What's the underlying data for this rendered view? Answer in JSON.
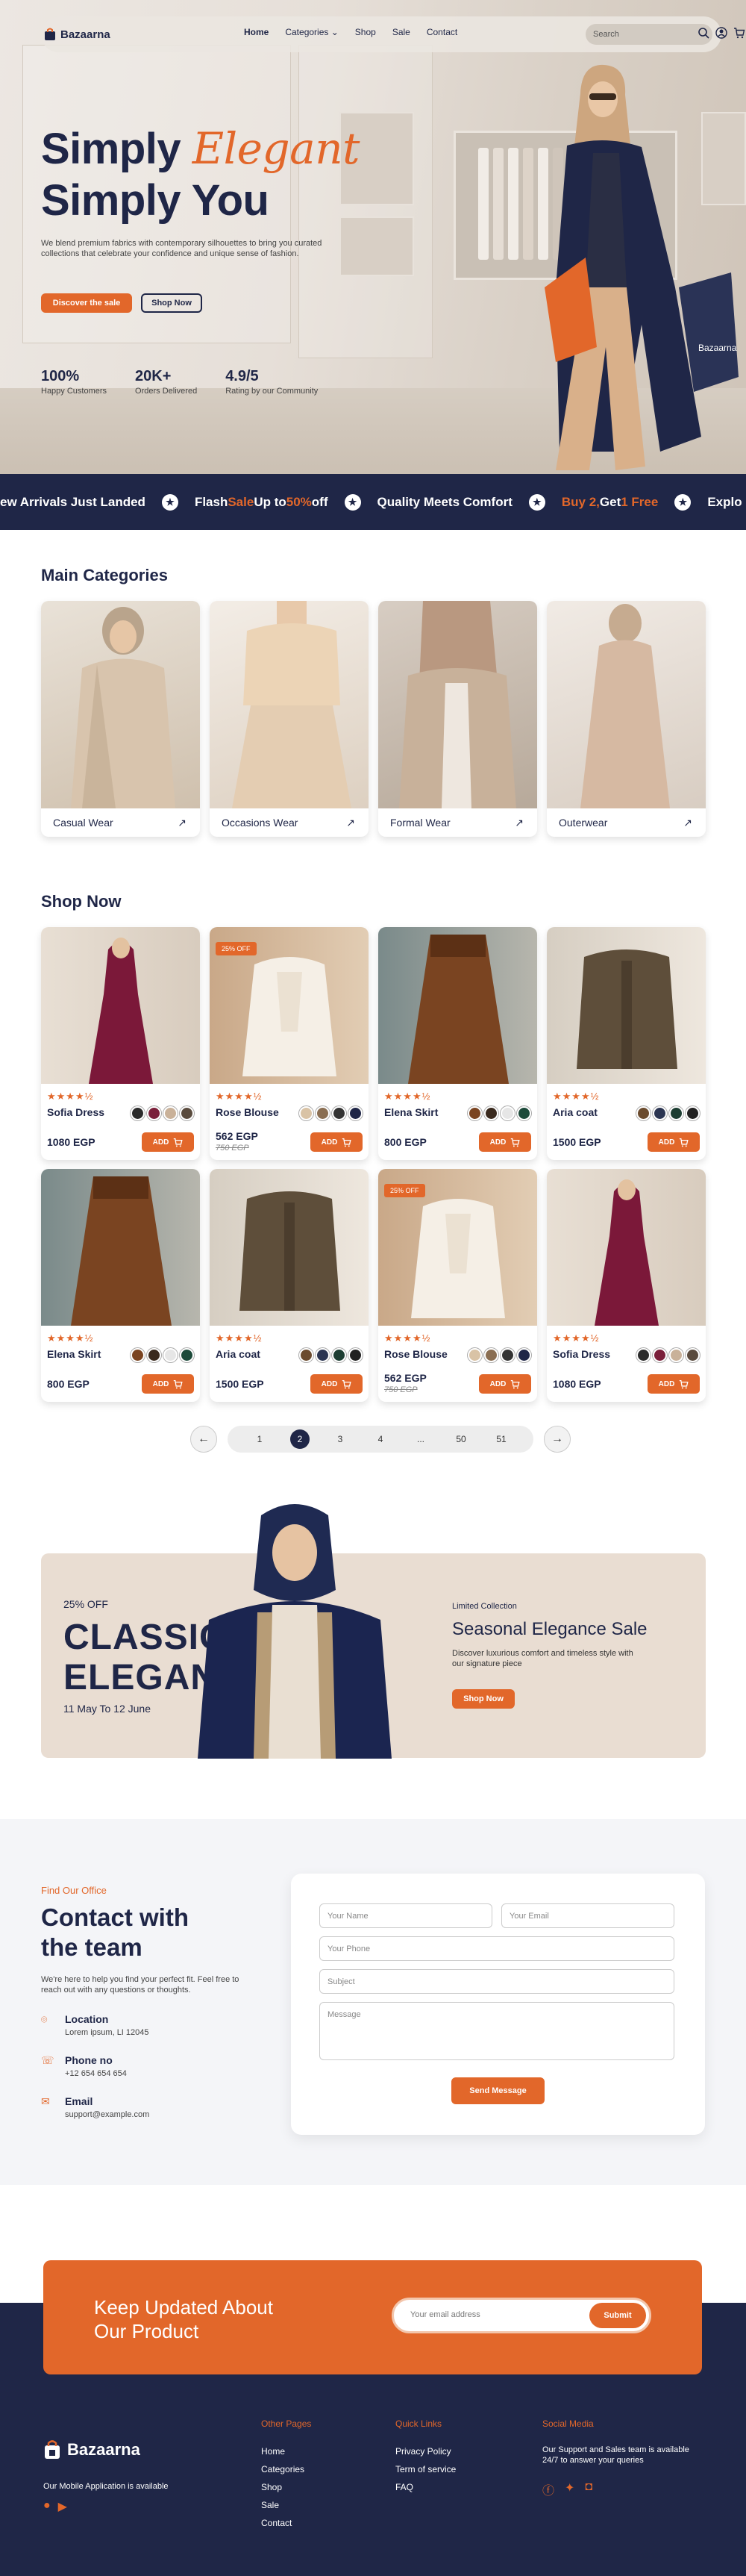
{
  "brand": "Bazaarna",
  "nav": {
    "links": [
      "Home",
      "Categories",
      "Shop",
      "Sale",
      "Contact"
    ],
    "search_placeholder": "Search"
  },
  "hero": {
    "line1_a": "Simply",
    "line1_b": "Elegant",
    "line2": "Simply You",
    "description": "We blend premium fabrics with contemporary silhouettes to bring you curated collections that celebrate your confidence and unique sense of fashion.",
    "cta_primary": "Discover the sale",
    "cta_secondary": "Shop Now",
    "stats": [
      {
        "value": "100%",
        "label": "Happy Customers"
      },
      {
        "value": "20K+",
        "label": "Orders Delivered"
      },
      {
        "value": "4.9/5",
        "label": "Rating by our Community"
      }
    ],
    "bag_label": "Bazaarna"
  },
  "ticker": {
    "item1": "ew Arrivals Just Landed",
    "item2_a": "Flash ",
    "item2_b": "Sale",
    "item2_c": " Up to ",
    "item2_d": "50%",
    "item2_e": " off",
    "item3": "Quality Meets Comfort",
    "item4_a": "Buy 2,",
    "item4_b": " Get ",
    "item4_c": "1 Free",
    "item5": "Explo"
  },
  "categories": {
    "title": "Main Categories",
    "items": [
      "Casual Wear",
      "Occasions Wear",
      "Formal Wear",
      "Outerwear"
    ]
  },
  "shop": {
    "title": "Shop Now",
    "currency_add": "ADD",
    "products": [
      {
        "name": "Sofia Dress",
        "price": "1080 EGP",
        "old_price": "",
        "badge": ""
      },
      {
        "name": "Rose Blouse",
        "price": "562 EGP",
        "old_price": "750 EGP",
        "badge": "25% OFF"
      },
      {
        "name": "Elena Skirt",
        "price": "800 EGP",
        "old_price": "",
        "badge": ""
      },
      {
        "name": "Aria coat",
        "price": "1500 EGP",
        "old_price": "",
        "badge": ""
      },
      {
        "name": "Elena Skirt",
        "price": "800 EGP",
        "old_price": "",
        "badge": ""
      },
      {
        "name": "Aria coat",
        "price": "1500 EGP",
        "old_price": "",
        "badge": ""
      },
      {
        "name": "Rose Blouse",
        "price": "562 EGP",
        "old_price": "750 EGP",
        "badge": "25% OFF"
      },
      {
        "name": "Sofia Dress",
        "price": "1080 EGP",
        "old_price": "",
        "badge": ""
      }
    ],
    "rating": "★★★★½"
  },
  "pagination": {
    "pages": [
      "1",
      "2",
      "3",
      "4",
      "...",
      "50",
      "51"
    ],
    "active": "2"
  },
  "promo": {
    "discount": "25% OFF",
    "headline1": "CLASSIC",
    "headline2": "ELEGANCE",
    "dates": "11 May To 12 June",
    "kicker": "Limited Collection",
    "title": "Seasonal Elegance Sale",
    "text": "Discover luxurious comfort and timeless style with our signature piece",
    "cta": "Shop Now"
  },
  "contact": {
    "kicker": "Find Our Office",
    "title1": "Contact with",
    "title2": "the team",
    "text": "We're here to help you find your perfect fit. Feel free to reach out with any questions or thoughts.",
    "location_title": "Location",
    "location_value": "Lorem ipsum, LI 12045",
    "phone_title": "Phone no",
    "phone_value": "+12 654 654 654",
    "email_title": "Email",
    "email_value": "support@example.com",
    "form": {
      "name": "Your Name",
      "email": "Your Email",
      "phone": "Your Phone",
      "subject": "Subject",
      "message": "Message",
      "submit": "Send Message"
    }
  },
  "newsletter": {
    "title1": "Keep Updated About",
    "title2": "Our Product",
    "placeholder": "Your email address",
    "submit": "Submit"
  },
  "footer": {
    "tagline": "Our Mobile Application is available",
    "other_pages_title": "Other Pages",
    "other_pages": [
      "Home",
      "Categories",
      "Shop",
      "Sale",
      "Contact"
    ],
    "quick_links_title": "Quick Links",
    "quick_links": [
      "Privacy Policy",
      "Term of service",
      "FAQ"
    ],
    "social_title": "Social Media",
    "social_text": "Our Support and Sales team is available 24/7 to answer your queries"
  },
  "colors": {
    "navy": "#1f2647",
    "orange": "#e2672a"
  }
}
